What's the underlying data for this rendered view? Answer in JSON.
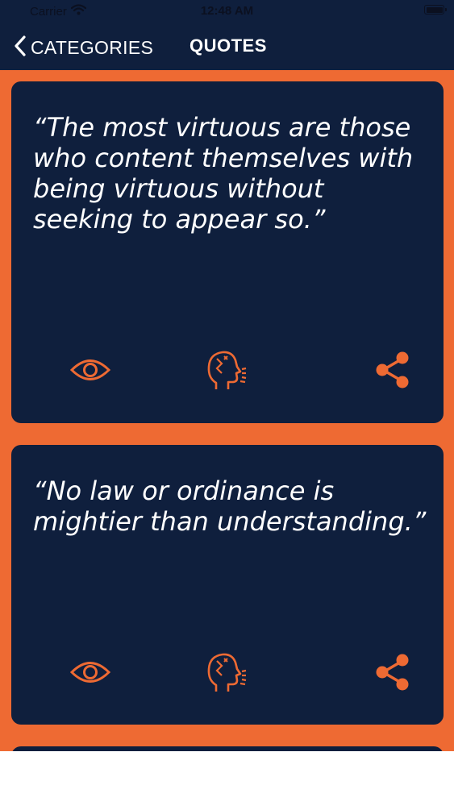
{
  "status_bar": {
    "carrier": "Carrier",
    "time": "12:48 AM"
  },
  "nav": {
    "back_label": "CATEGORIES",
    "title": "QUOTES"
  },
  "quotes": [
    {
      "text": "“The most virtuous are those who content themselves with being virtuous without seeking to appear so.”",
      "actions": [
        "eye-icon",
        "speak-icon",
        "share-icon"
      ]
    },
    {
      "text": "“No law or ordinance is mightier than understanding.”",
      "actions": [
        "eye-icon",
        "speak-icon",
        "share-icon"
      ]
    }
  ],
  "colors": {
    "navy": "#0f1f3d",
    "orange": "#ee6a33",
    "white": "#ffffff"
  }
}
